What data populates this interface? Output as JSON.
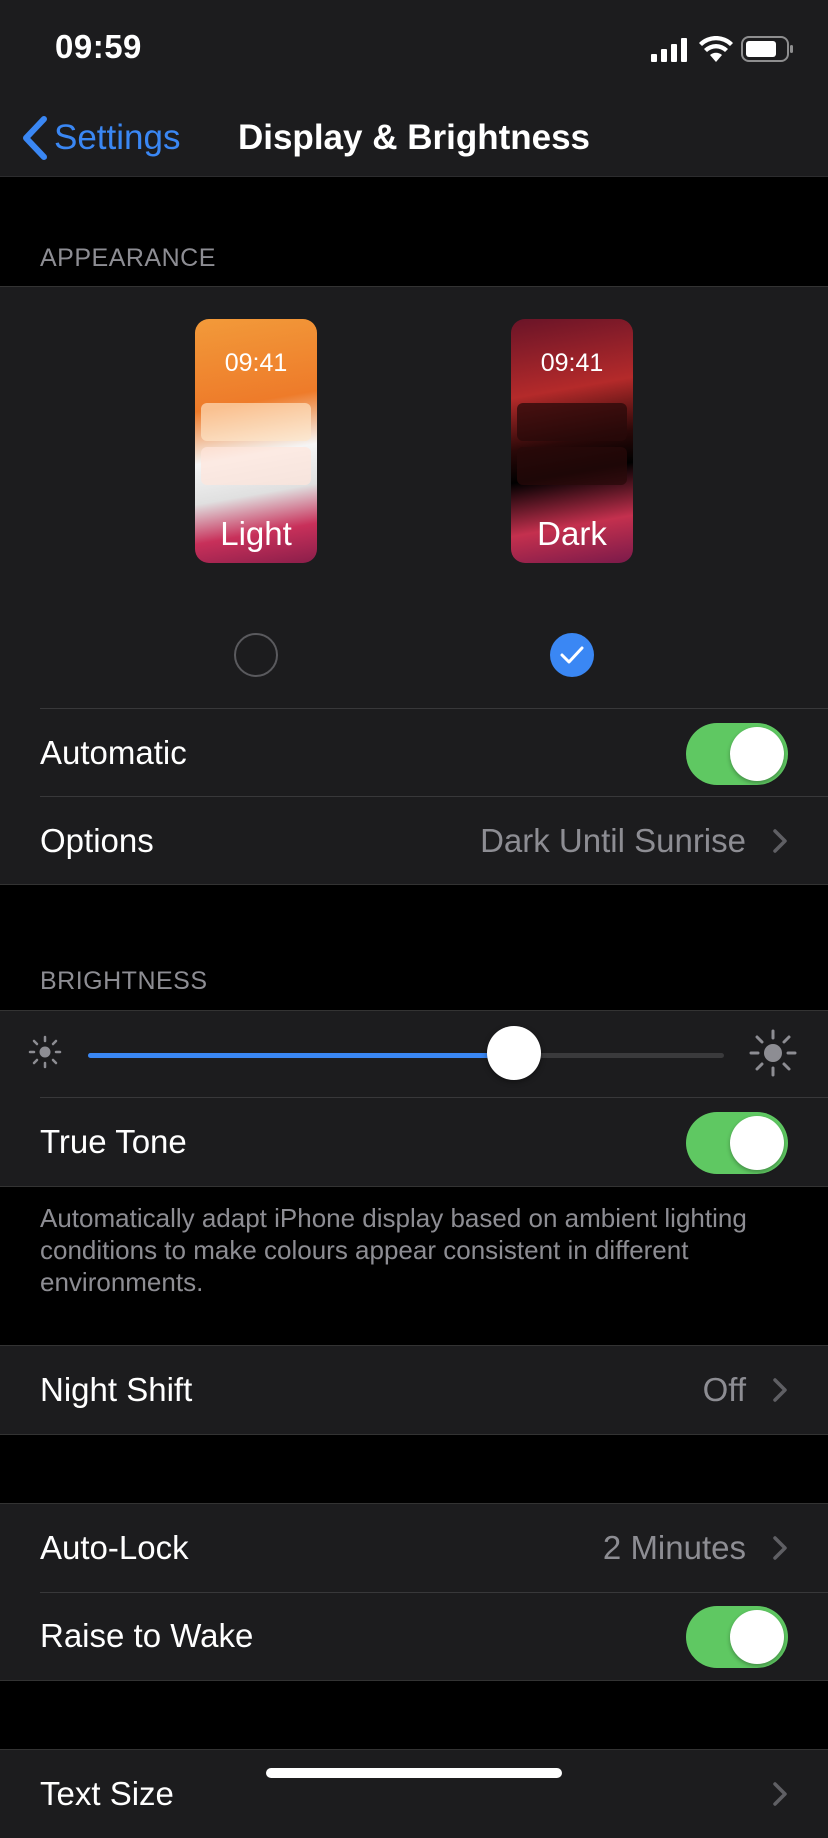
{
  "status_bar": {
    "time": "09:59",
    "signal_icon": "cellular-signal-icon",
    "wifi_icon": "wifi-icon",
    "battery_icon": "battery-icon"
  },
  "nav": {
    "back_label": "Settings",
    "title": "Display & Brightness",
    "back_icon": "chevron-left-icon"
  },
  "appearance": {
    "header": "APPEARANCE",
    "options": [
      {
        "label": "Light",
        "preview_time": "09:41",
        "selected": false
      },
      {
        "label": "Dark",
        "preview_time": "09:41",
        "selected": true
      }
    ],
    "automatic": {
      "label": "Automatic",
      "on": true
    },
    "options_row": {
      "label": "Options",
      "value": "Dark Until Sunrise"
    }
  },
  "brightness": {
    "header": "BRIGHTNESS",
    "level": 0.67,
    "min_icon": "sun-small-icon",
    "max_icon": "sun-large-icon",
    "true_tone": {
      "label": "True Tone",
      "on": true
    },
    "footer": "Automatically adapt iPhone display based on ambient lighting conditions to make colours appear consistent in different environments."
  },
  "night_shift": {
    "label": "Night Shift",
    "value": "Off"
  },
  "lock": {
    "auto_lock": {
      "label": "Auto-Lock",
      "value": "2 Minutes"
    },
    "raise_to_wake": {
      "label": "Raise to Wake",
      "on": true
    }
  },
  "text": {
    "text_size": {
      "label": "Text Size"
    }
  },
  "colors": {
    "accent": "#3a87f4",
    "toggle_on": "#5fc862",
    "cell_bg": "#1c1c1e",
    "secondary_text": "#8d8d93"
  }
}
